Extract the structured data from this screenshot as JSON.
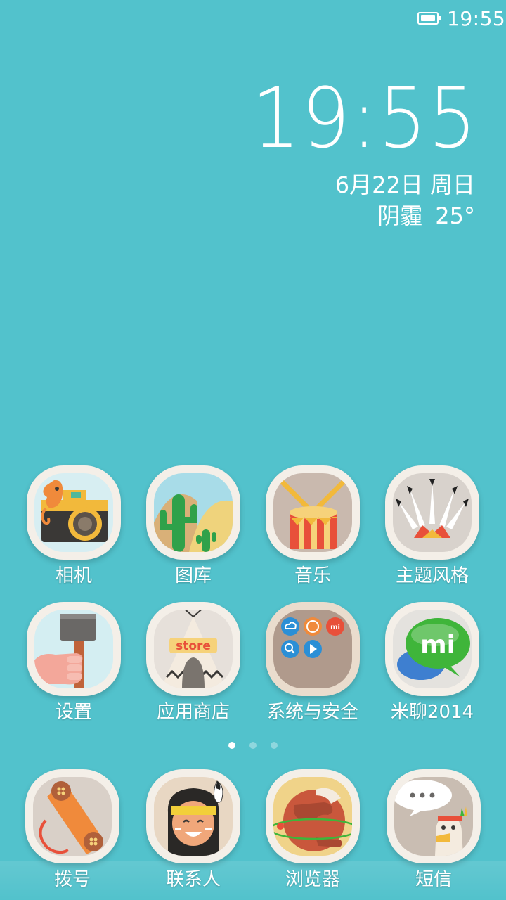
{
  "status_bar": {
    "time": "19:55",
    "battery_icon": "battery-full-icon"
  },
  "widget": {
    "time": "19:55",
    "date": "6月22日 周日",
    "weather": "阴霾",
    "temperature": "25°"
  },
  "apps": [
    {
      "label": "相机",
      "icon": "camera-icon"
    },
    {
      "label": "图库",
      "icon": "cactus-icon"
    },
    {
      "label": "音乐",
      "icon": "drum-icon"
    },
    {
      "label": "主题风格",
      "icon": "feather-headdress-icon"
    },
    {
      "label": "设置",
      "icon": "hammer-icon"
    },
    {
      "label": "应用商店",
      "icon": "teepee-store-icon"
    },
    {
      "label": "系统与安全",
      "icon": "folder-icon"
    },
    {
      "label": "米聊2014",
      "icon": "miliao-icon"
    }
  ],
  "folder_badge": "mi",
  "store_sign": "store",
  "miliao_logo": "mi",
  "page_indicator": {
    "count": 3,
    "active": 0
  },
  "dock": [
    {
      "label": "拨号",
      "icon": "phone-icon"
    },
    {
      "label": "联系人",
      "icon": "contacts-icon"
    },
    {
      "label": "浏览器",
      "icon": "browser-icon"
    },
    {
      "label": "短信",
      "icon": "messages-icon"
    }
  ]
}
